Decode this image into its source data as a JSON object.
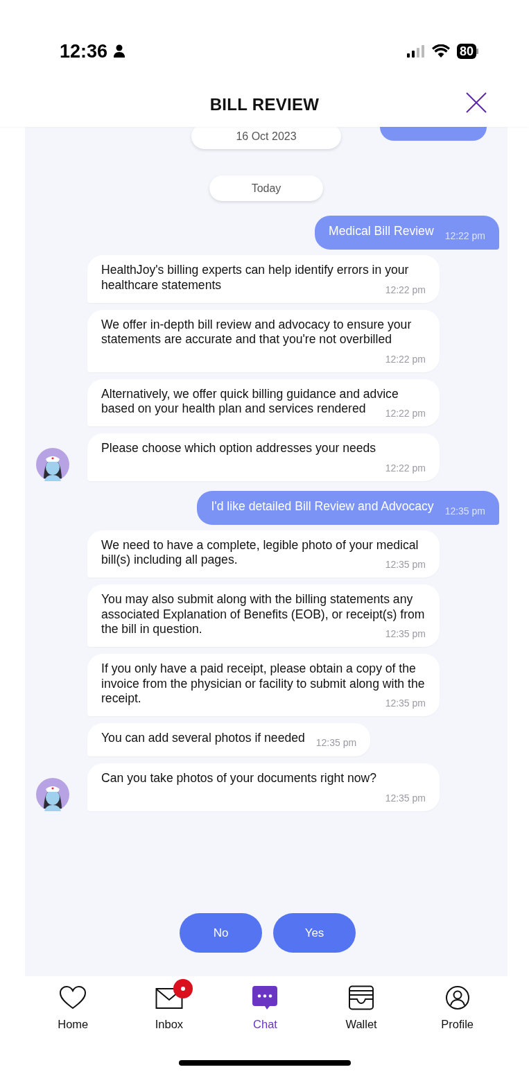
{
  "status_bar": {
    "time": "12:36",
    "battery": "80"
  },
  "header": {
    "title": "BILL REVIEW"
  },
  "chat": {
    "bubble_cut_above": true,
    "items": [
      {
        "kind": "date",
        "text": "16 Oct 2023"
      },
      {
        "kind": "date",
        "text": "Today"
      },
      {
        "kind": "out",
        "text": "Medical Bill Review",
        "time": "12:22 pm"
      },
      {
        "kind": "in",
        "text": "HealthJoy's billing experts can help identify errors in your healthcare statements",
        "time": "12:22 pm",
        "avatar": false
      },
      {
        "kind": "in",
        "text": "We offer in-depth bill review and advocacy to ensure your statements are accurate and that you're not overbilled",
        "time": "12:22 pm",
        "avatar": false
      },
      {
        "kind": "in",
        "text": "Alternatively, we offer quick billing guidance and advice based on your health plan and services rendered",
        "time": "12:22 pm",
        "avatar": false
      },
      {
        "kind": "in",
        "text": "Please choose which option addresses your needs",
        "time": "12:22 pm",
        "avatar": true
      },
      {
        "kind": "out",
        "text": "I'd like detailed Bill Review and Advocacy",
        "time": "12:35 pm"
      },
      {
        "kind": "in",
        "text": "We need to have a complete, legible photo of your medical bill(s) including all pages.",
        "time": "12:35 pm",
        "avatar": false
      },
      {
        "kind": "in",
        "text": "You may also submit along with the billing statements any associated Explanation of Benefits (EOB), or receipt(s) from the bill in question.",
        "time": "12:35 pm",
        "avatar": false
      },
      {
        "kind": "in",
        "text": "If you only have a paid receipt, please obtain a copy of the invoice from the physician or facility to submit along with the receipt.",
        "time": "12:35 pm",
        "avatar": false
      },
      {
        "kind": "in",
        "text": "You can add several photos if needed",
        "time": "12:35 pm",
        "avatar": false
      },
      {
        "kind": "in",
        "text": "Can you take photos of your documents right now?",
        "time": "12:35 pm",
        "avatar": true
      }
    ],
    "quick_replies": [
      "No",
      "Yes"
    ]
  },
  "nav": [
    {
      "label": "Home",
      "selected": false,
      "badge": false
    },
    {
      "label": "Inbox",
      "selected": false,
      "badge": true
    },
    {
      "label": "Chat",
      "selected": true,
      "badge": false
    },
    {
      "label": "Wallet",
      "selected": false,
      "badge": false
    },
    {
      "label": "Profile",
      "selected": false,
      "badge": false
    }
  ]
}
